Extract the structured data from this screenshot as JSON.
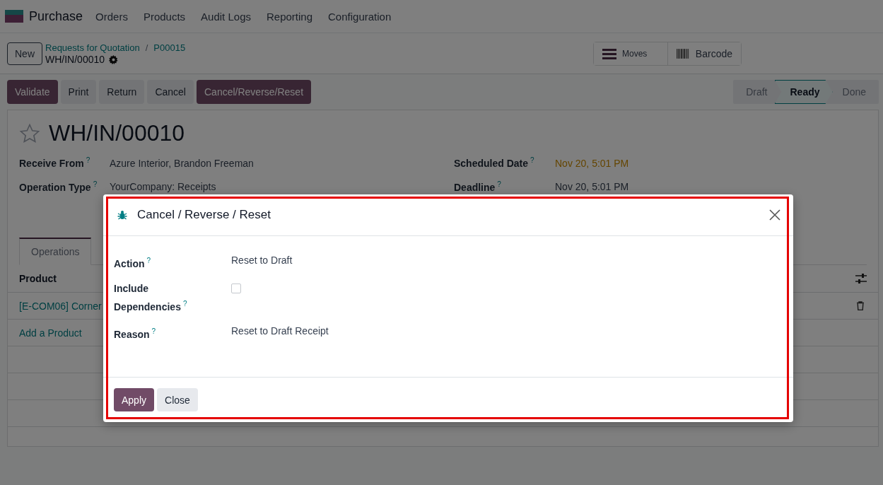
{
  "app": {
    "name": "Purchase",
    "menu": [
      "Orders",
      "Products",
      "Audit Logs",
      "Reporting",
      "Configuration"
    ]
  },
  "control_panel": {
    "new_button": "New",
    "breadcrumbs": [
      "Requests for Quotation",
      "P00015"
    ],
    "separator": "/",
    "record": "WH/IN/00010",
    "smart_buttons": [
      {
        "kind": "list",
        "label": "Moves"
      },
      {
        "kind": "barcode",
        "label": "Barcode"
      }
    ]
  },
  "actions": [
    {
      "label": "Validate",
      "primary": true
    },
    {
      "label": "Print",
      "primary": false
    },
    {
      "label": "Return",
      "primary": false
    },
    {
      "label": "Cancel",
      "primary": false
    },
    {
      "label": "Cancel/Reverse/Reset",
      "primary": true
    }
  ],
  "status_bar": [
    {
      "label": "Draft",
      "selected": false
    },
    {
      "label": "Ready",
      "selected": true
    },
    {
      "label": "Done",
      "selected": false
    }
  ],
  "form": {
    "title": "WH/IN/00010",
    "starred": false,
    "fields_left": [
      {
        "label": "Receive From",
        "help": "?",
        "value": "Azure Interior, Brandon Freeman",
        "warning": false
      },
      {
        "label": "Operation Type",
        "help": "?",
        "value": "YourCompany: Receipts",
        "warning": false
      }
    ],
    "fields_right": [
      {
        "label": "Scheduled Date",
        "help": "?",
        "value": "Nov 20, 5:01 PM",
        "warning": true
      },
      {
        "label": "Deadline",
        "help": "?",
        "value": "Nov 20, 5:01 PM",
        "warning": false
      }
    ],
    "tabs": [
      {
        "label": "Operations",
        "selected": true
      }
    ],
    "table": {
      "columns": [
        "Product"
      ],
      "rows": [
        {
          "product": "[E-COM06] Corner"
        }
      ],
      "add_line": "Add a Product"
    }
  },
  "dialog": {
    "title": "Cancel / Reverse / Reset",
    "fields": [
      {
        "kind": "text",
        "label": "Action",
        "help": "?",
        "value": "Reset to Draft"
      },
      {
        "kind": "checkbox",
        "label": "Include Dependencies",
        "help": "?",
        "checked": false
      },
      {
        "kind": "text",
        "label": "Reason",
        "help": "?",
        "value": "Reset to Draft Receipt"
      }
    ],
    "buttons": [
      {
        "label": "Apply",
        "primary": true
      },
      {
        "label": "Close",
        "primary": false
      }
    ]
  }
}
